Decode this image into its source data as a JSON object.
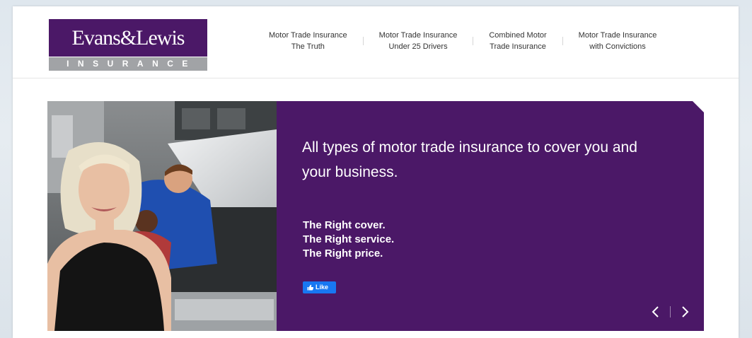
{
  "header": {
    "logo": {
      "brand": "Evans&Lewis",
      "sub": "INSURANCE"
    },
    "nav": [
      {
        "line1": "Motor Trade Insurance",
        "line2": "The Truth"
      },
      {
        "line1": "Motor Trade Insurance",
        "line2": "Under 25 Drivers"
      },
      {
        "line1": "Combined Motor",
        "line2": "Trade Insurance"
      },
      {
        "line1": "Motor Trade Insurance",
        "line2": "with Convictions"
      }
    ]
  },
  "hero": {
    "headline": "All types of motor trade insurance to cover you and your business.",
    "tagline": [
      "The Right cover.",
      "The Right service.",
      "The Right price."
    ],
    "like_label": "Like",
    "prev_icon": "chevron-left-icon",
    "next_icon": "chevron-right-icon"
  },
  "colors": {
    "brand_purple": "#4b1867",
    "logo_grey": "#a1a3a6",
    "facebook_blue": "#1877f2",
    "page_bg": "#dfe7ee"
  }
}
